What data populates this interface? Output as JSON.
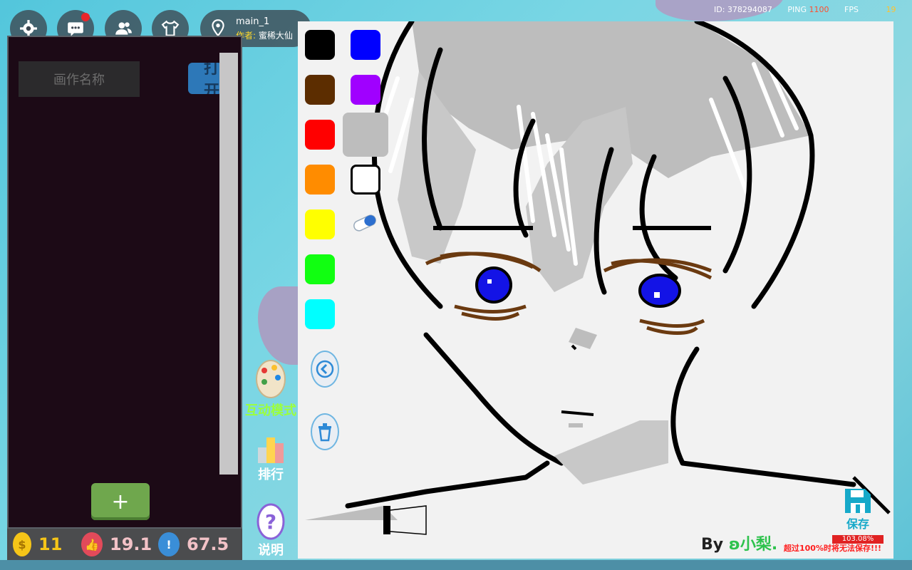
{
  "topbar": {
    "buttons": [
      {
        "icon": "gear-icon"
      },
      {
        "icon": "chat-icon"
      },
      {
        "icon": "friends-icon"
      },
      {
        "icon": "wardrobe-icon"
      }
    ],
    "map": {
      "icon": "map-pin-icon",
      "name": "main_1",
      "author_label": "作者:",
      "author": "蜜稀大仙"
    },
    "status": {
      "id": "ID: 378294087",
      "ping_label": "PING",
      "ping_value": "1100",
      "fps_label": "FPS",
      "fps_value": "19"
    }
  },
  "left_panel": {
    "name_placeholder": "画作名称",
    "open_button": "打开",
    "add_button": "+"
  },
  "stats": [
    {
      "icon": "coin-icon",
      "value": "11",
      "color": "#f5c518"
    },
    {
      "icon": "like-icon",
      "value": "19.1",
      "color": "#e24a5a"
    },
    {
      "icon": "alert-icon",
      "value": "67.5",
      "color": "#3a8ed8"
    }
  ],
  "side_menu": [
    {
      "icon": "palette-icon",
      "label": "互动模式",
      "color": "#9cff3c"
    },
    {
      "icon": "ranking-icon",
      "label": "排行",
      "color": "#ffffff"
    },
    {
      "icon": "question-icon",
      "label": "说明",
      "color": "#ffffff"
    }
  ],
  "palette": {
    "left_column": [
      "#000000",
      "#5c2d00",
      "#ff0000",
      "#ff8c00",
      "#ffff00",
      "#11ff11",
      "#00ffff"
    ],
    "right_column": [
      "#0000ff",
      "#a000ff",
      "#bdbdbd",
      "#ffffff"
    ],
    "tools": [
      {
        "icon": "eraser-icon"
      },
      {
        "icon": "back-icon"
      },
      {
        "icon": "trash-icon"
      }
    ]
  },
  "canvas": {
    "signature_by": "By",
    "signature_name": "ʚ小梨.",
    "save_label": "保存",
    "save_icon": "save-icon",
    "progress_text": "103.08%",
    "progress_fraction": 1.0,
    "warning": "超过100%时将无法保存!!!"
  }
}
